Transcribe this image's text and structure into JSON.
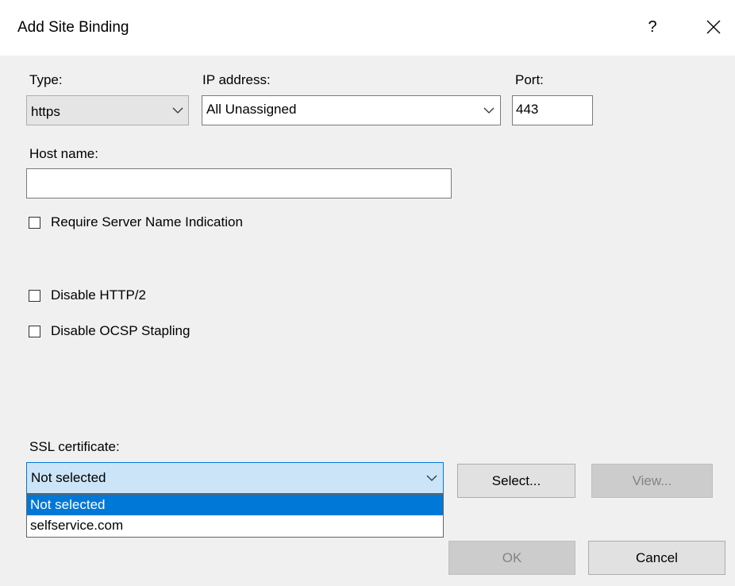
{
  "dialog": {
    "title": "Add Site Binding",
    "help_glyph": "?",
    "close_icon": "close-icon"
  },
  "type": {
    "label": "Type:",
    "value": "https"
  },
  "ip": {
    "label": "IP address:",
    "value": "All Unassigned"
  },
  "port": {
    "label": "Port:",
    "value": "443"
  },
  "host": {
    "label": "Host name:",
    "value": ""
  },
  "checkboxes": {
    "sni": "Require Server Name Indication",
    "http2": "Disable HTTP/2",
    "ocsp": "Disable OCSP Stapling"
  },
  "ssl": {
    "label": "SSL certificate:",
    "value": "Not selected",
    "options": [
      "Not selected",
      "selfservice.com"
    ],
    "selected_index": 0
  },
  "buttons": {
    "select": "Select...",
    "view": "View...",
    "ok": "OK",
    "cancel": "Cancel"
  },
  "colors": {
    "highlight": "#0078d7",
    "focus_fill": "#cce4f7",
    "focus_border": "#0078d7"
  }
}
